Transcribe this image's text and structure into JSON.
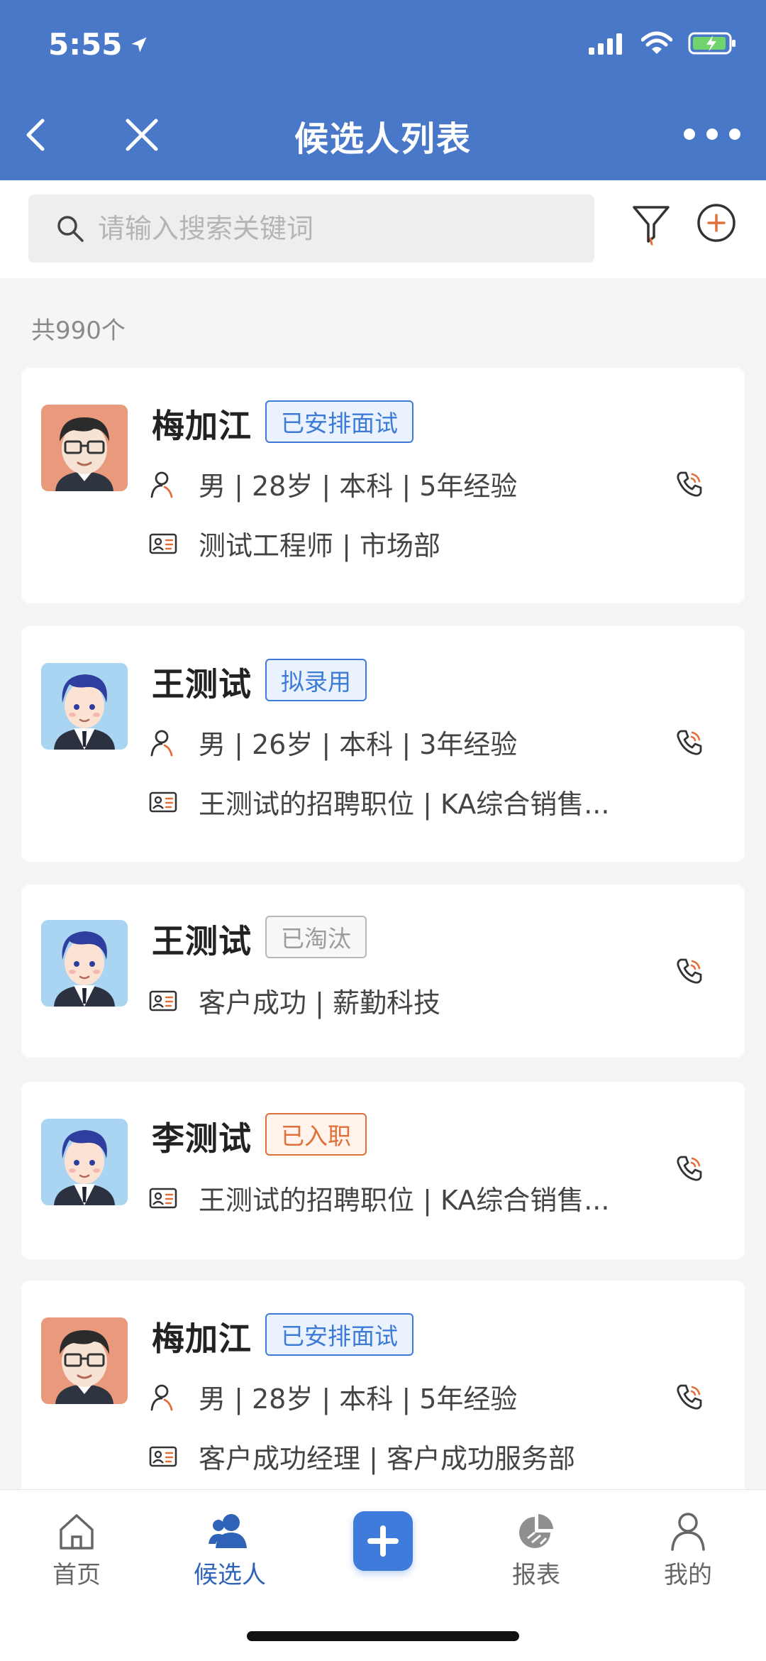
{
  "status": {
    "time": "5:55"
  },
  "nav": {
    "title": "候选人列表"
  },
  "search": {
    "placeholder": "请输入搜索关键词"
  },
  "count": "共990个",
  "colors": {
    "brand": "#4a78c9",
    "tag_blue": "#3d7bd6",
    "tag_orange": "#e0703a",
    "tag_gray": "#9c9c9c",
    "phone_accent": "#e0703a"
  },
  "candidates": [
    {
      "name": "梅加江",
      "tag": "已安排面试",
      "tag_style": "blue",
      "info": "男 | 28岁 | 本科 | 5年经验",
      "position": "测试工程师 | 市场部",
      "avatar": "male-glasses-avatar"
    },
    {
      "name": "王测试",
      "tag": "拟录用",
      "tag_style": "blue",
      "info": "男 | 26岁 | 本科 | 3年经验",
      "position": "王测试的招聘职位 | KA综合销售...",
      "avatar": "male-suit-avatar"
    },
    {
      "name": "王测试",
      "tag": "已淘汰",
      "tag_style": "gray",
      "info": "",
      "position": "客户成功 | 薪勤科技",
      "avatar": "male-suit-avatar"
    },
    {
      "name": "李测试",
      "tag": "已入职",
      "tag_style": "orange",
      "info": "",
      "position": "王测试的招聘职位 | KA综合销售...",
      "avatar": "male-suit-avatar"
    },
    {
      "name": "梅加江",
      "tag": "已安排面试",
      "tag_style": "blue",
      "info": "男 | 28岁 | 本科 | 5年经验",
      "position": "客户成功经理 | 客户成功服务部",
      "avatar": "male-glasses-avatar"
    }
  ],
  "tabs": [
    {
      "label": "首页",
      "icon": "home-icon"
    },
    {
      "label": "候选人",
      "icon": "users-icon",
      "active": true
    },
    {
      "label": "",
      "icon": "plus-icon"
    },
    {
      "label": "报表",
      "icon": "pie-chart-icon"
    },
    {
      "label": "我的",
      "icon": "person-icon"
    }
  ]
}
